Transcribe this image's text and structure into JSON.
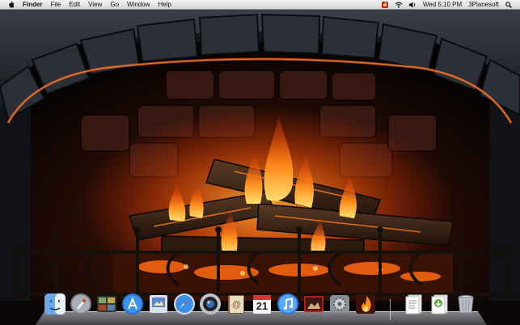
{
  "menubar": {
    "app_name": "Finder",
    "menus": [
      "File",
      "Edit",
      "View",
      "Go",
      "Window",
      "Help"
    ],
    "clock": "Wed 5:10 PM",
    "user": "3Planesoft"
  },
  "dock": {
    "items": [
      {
        "name": "Finder",
        "icon": "finder-icon"
      },
      {
        "name": "Launchpad",
        "icon": "launchpad-icon"
      },
      {
        "name": "Photo Booth",
        "icon": "photo-booth-icon"
      },
      {
        "name": "App Store",
        "icon": "app-store-icon"
      },
      {
        "name": "Preview",
        "icon": "preview-icon"
      },
      {
        "name": "Safari",
        "icon": "safari-icon"
      },
      {
        "name": "FaceTime",
        "icon": "facetime-icon"
      },
      {
        "name": "Address Book",
        "icon": "address-book-icon"
      },
      {
        "name": "iCal",
        "icon": "calendar-icon"
      },
      {
        "name": "iTunes",
        "icon": "itunes-icon"
      },
      {
        "name": "Photo Slideshow",
        "icon": "photo-slideshow-icon"
      },
      {
        "name": "System Preferences",
        "icon": "system-preferences-icon"
      },
      {
        "name": "Fireplace",
        "icon": "fireplace-icon"
      },
      {
        "name": "Documents",
        "icon": "documents-icon"
      },
      {
        "name": "Downloads",
        "icon": "downloads-icon"
      },
      {
        "name": "Trash",
        "icon": "trash-icon"
      }
    ],
    "calendar_day": "21"
  },
  "colors": {
    "menubar_bg": "#e8e8e8",
    "fire_orange": "#ff7a18",
    "ember_red": "#c0221b"
  }
}
